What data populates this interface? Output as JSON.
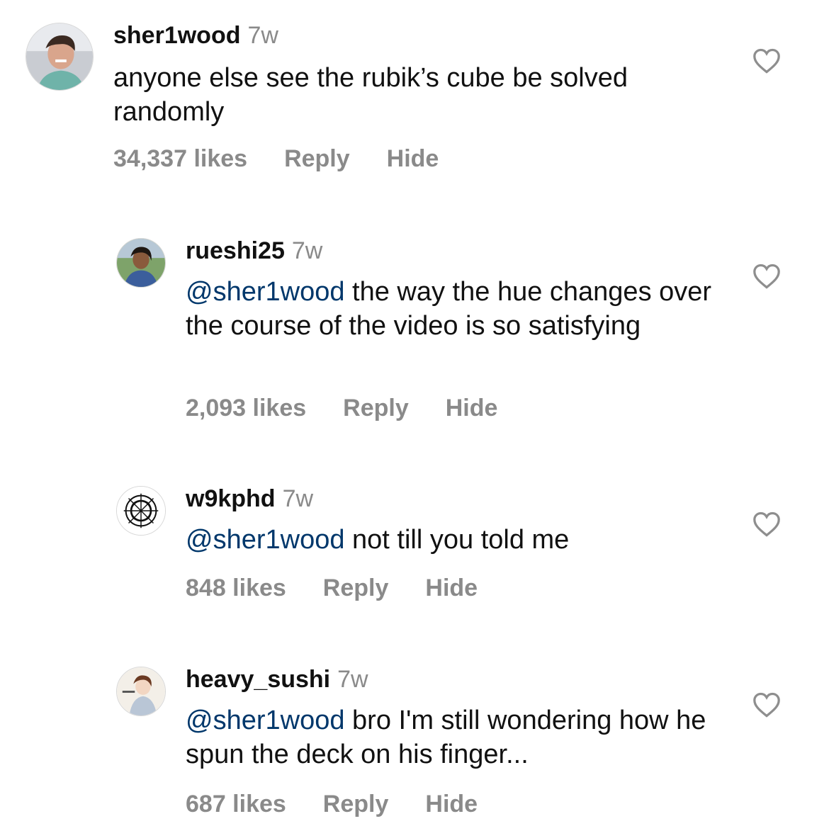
{
  "comments": [
    {
      "username": "sher1wood",
      "time": "7w",
      "mention": "",
      "text": "anyone else see the rubik’s cube be solved randomly",
      "likes": "34,337 likes",
      "reply": "Reply",
      "hide": "Hide"
    },
    {
      "username": "rueshi25",
      "time": "7w",
      "mention": "@sher1wood",
      "text": " the way the hue changes over the course of the video is so satisfying",
      "likes": "2,093 likes",
      "reply": "Reply",
      "hide": "Hide"
    },
    {
      "username": "w9kphd",
      "time": "7w",
      "mention": "@sher1wood",
      "text": " not till you told me",
      "likes": "848 likes",
      "reply": "Reply",
      "hide": "Hide"
    },
    {
      "username": "heavy_sushi",
      "time": "7w",
      "mention": "@sher1wood",
      "text": " bro I'm still wondering how he spun the deck on his finger...",
      "likes": "687 likes",
      "reply": "Reply",
      "hide": "Hide"
    }
  ],
  "colors": {
    "mention": "#00376b",
    "muted": "#8a8a8a",
    "text": "#111111"
  },
  "icons": [
    "avatar",
    "heart-icon"
  ]
}
